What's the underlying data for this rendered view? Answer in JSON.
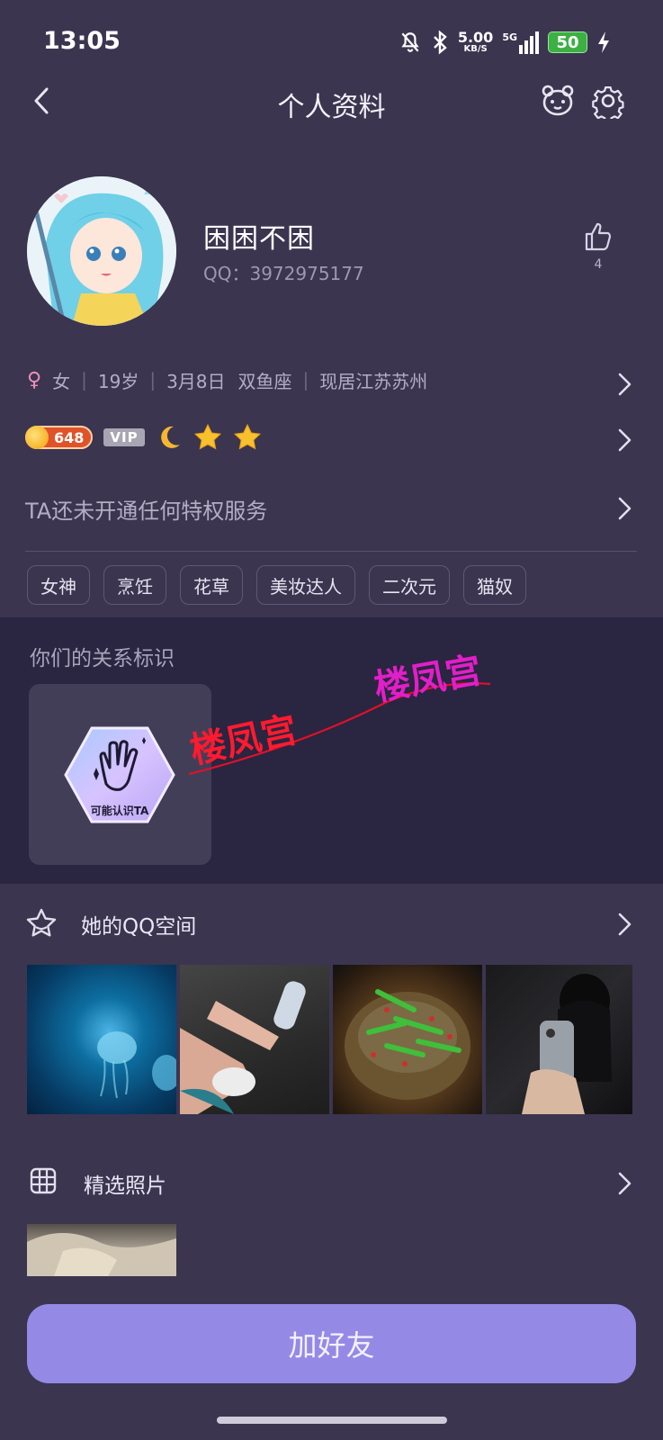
{
  "status_bar": {
    "time": "13:05",
    "net_speed": "5.00",
    "net_unit": "KB/S",
    "signal": "5G",
    "battery": "50"
  },
  "header": {
    "title": "个人资料"
  },
  "profile": {
    "nickname": "困困不困",
    "qq_label": "QQ：3972975177",
    "like_count": "4"
  },
  "info": {
    "gender": "女",
    "age": "19岁",
    "birthday": "3月8日",
    "zodiac": "双鱼座",
    "location": "现居江苏苏州"
  },
  "badges": {
    "level": "648",
    "vip": "VIP"
  },
  "privilege": {
    "text": "TA还未开通任何特权服务"
  },
  "tags": [
    "女神",
    "烹饪",
    "花草",
    "美妆达人",
    "二次元",
    "猫奴"
  ],
  "relation": {
    "title": "你们的关系标识",
    "badge_label": "可能认识TA"
  },
  "watermark": {
    "text1": "楼凤宫",
    "text2": "楼凤宫"
  },
  "qzone": {
    "title": "她的QQ空间"
  },
  "selected_photos": {
    "title": "精选照片"
  },
  "action": {
    "add_friend": "加好友"
  },
  "colors": {
    "background": "#3b3550",
    "section_dark": "#2a2540",
    "primary_button": "#948ae6"
  }
}
